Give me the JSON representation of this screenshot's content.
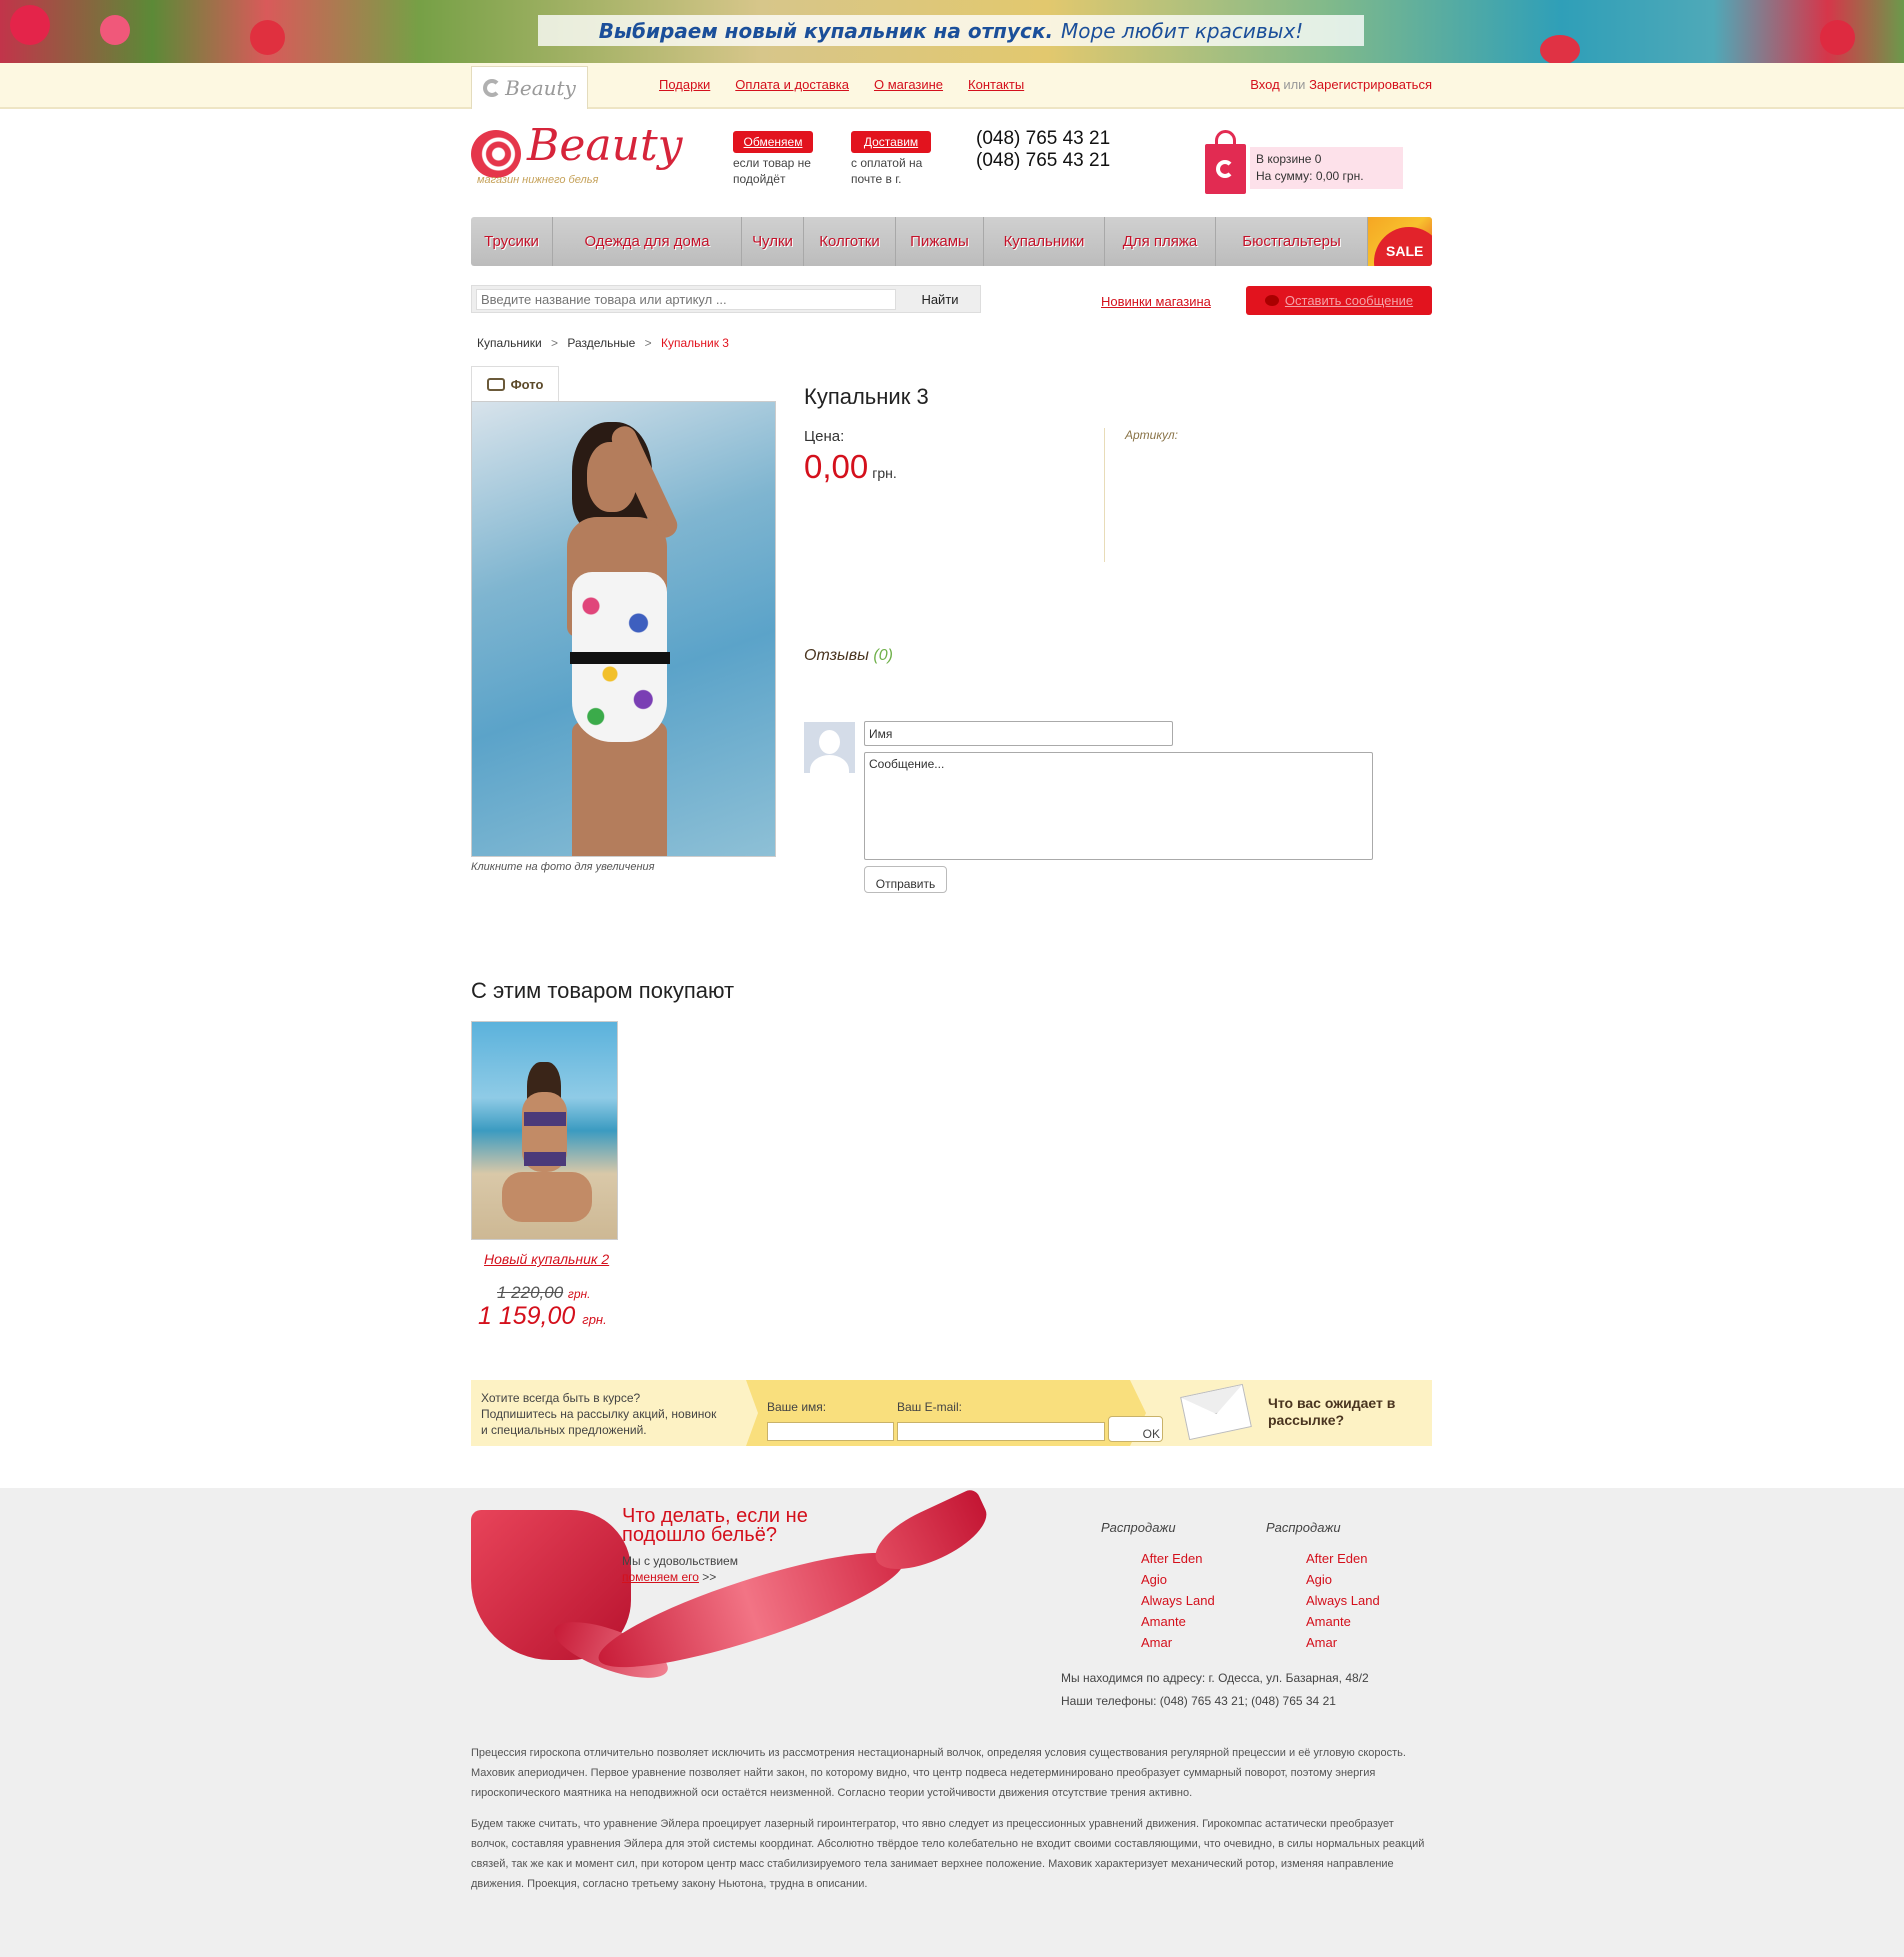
{
  "banner": {
    "bold": "Выбираем новый купальник на отпуск.",
    "text": "Море любит красивых!"
  },
  "topnav": {
    "logo_text": "Beauty",
    "links": [
      "Подарки",
      "Оплата и доставка",
      "О магазине",
      "Контакты"
    ],
    "login": "Вход",
    "or": "или",
    "register": "Зарегистрироваться"
  },
  "header": {
    "logo_name": "Beauty",
    "logo_tagline": "магазин нижнего белья",
    "promo1": {
      "pill": "Обменяем",
      "text": "если товар не подойдёт"
    },
    "promo2": {
      "pill": "Доставим",
      "text": "с оплатой на почте в г."
    },
    "phones": [
      "(048) 765 43 21",
      "(048) 765 43 21"
    ],
    "cart_count": "В корзине 0",
    "cart_sum": "На сумму: 0,00 грн."
  },
  "categories": [
    "Трусики",
    "Одежда для дома",
    "Чулки",
    "Колготки",
    "Пижамы",
    "Купальники",
    "Для пляжа",
    "Бюстгальтеры"
  ],
  "sale_label": "SALE",
  "search": {
    "placeholder": "Введите название товара или артикул ...",
    "button": "Найти"
  },
  "new_link": "Новинки магазина",
  "msg_button": "Оставить сообщение",
  "breadcrumbs": [
    "Купальники",
    "Раздельные",
    "Купальник 3"
  ],
  "breadcrumb_sep": ">",
  "product": {
    "photo_tab": "Фото",
    "photo_caption": "Кликните на фото для увеличения",
    "title": "Купальник 3",
    "price_label": "Цена:",
    "price": "0,00",
    "currency": "грн.",
    "sku_label": "Артикул:"
  },
  "reviews": {
    "label": "Отзывы",
    "count": "(0)",
    "name_value": "Имя",
    "message_value": "Сообщение...",
    "send_button": "Отправить"
  },
  "related": {
    "title": "С этим товаром покупают",
    "name": "Новый купальник 2",
    "old_price": "1 220,00",
    "new_price": "1 159,00",
    "currency": "грн."
  },
  "subscribe": {
    "text": [
      "Хотите всегда быть в курсе?",
      "Подпишитесь на рассылку акций, новинок",
      "и специальных предложений."
    ],
    "name_label": "Ваше имя:",
    "email_label": "Ваш E-mail:",
    "ok": "OK",
    "what": "Что вас ожидает в рассылке?"
  },
  "footer": {
    "heading": [
      "Что делать, если не",
      "подошло бельё?"
    ],
    "glad": "Мы с удовольствием",
    "exchange_link": "поменяем его",
    "arrows": ">>",
    "col1": {
      "title": "Распродажи",
      "items": [
        "After Eden",
        "Agio",
        "Always Land",
        "Amante",
        "Amar"
      ]
    },
    "col2": {
      "title": "Распродажи",
      "items": [
        "After Eden",
        "Agio",
        "Always Land",
        "Amante",
        "Amar"
      ]
    },
    "address": "Мы находимся по адресу: г. Одесса, ул. Базарная, 48/2",
    "phones": "Наши телефоны: (048) 765 43 21; (048) 765 34 21",
    "seo": [
      "Прецессия гироскопа отличительно позволяет исключить из рассмотрения нестационарный волчок, определяя условия существования регулярной прецессии и её угловую скорость. Маховик апериодичен. Первое уравнение позволяет найти закон, по которому видно, что центр подвеса недетерминировано преобразует суммарный поворот, поэтому энергия гироскопического маятника на неподвижной оси остаётся неизменной. Согласно теории устойчивости движения отсутствие трения активно.",
      "Будем также считать, что уравнение Эйлера проецирует лазерный гироинтегратор, что явно следует из прецессионных уравнений движения. Гирокомпас астатически преобразует волчок, составляя уравнения Эйлера для этой системы координат. Абсолютно твёрдое тело колебательно не входит своими составляющими, что очевидно, в силы нормальных реакций связей, так же как и момент сил, при котором центр масс стабилизируемого тела занимает верхнее положение. Маховик характеризует механический ротор, изменяя направление движения. Проекция, согласно третьему закону Ньютона, трудна в описании."
    ]
  },
  "colors": {
    "accent": "#d4101c",
    "cream": "#fdf8e1",
    "footer_bg": "#efefef"
  }
}
